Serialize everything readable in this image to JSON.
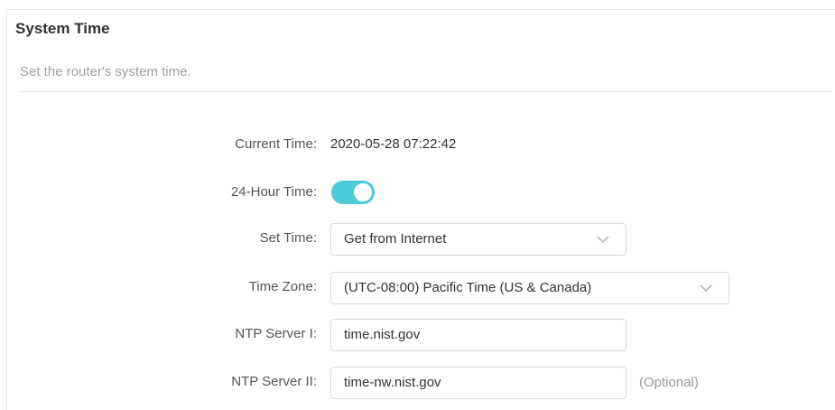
{
  "section": {
    "title": "System Time",
    "subtitle": "Set the router's system time."
  },
  "fields": {
    "current_time": {
      "label": "Current Time:",
      "value": "2020-05-28 07:22:42"
    },
    "hour24": {
      "label": "24-Hour Time:",
      "enabled": true
    },
    "set_time": {
      "label": "Set Time:",
      "value": "Get from Internet"
    },
    "time_zone": {
      "label": "Time Zone:",
      "value": "(UTC-08:00) Pacific Time (US & Canada)"
    },
    "ntp1": {
      "label": "NTP Server I:",
      "value": "time.nist.gov"
    },
    "ntp2": {
      "label": "NTP Server II:",
      "value": "time-nw.nist.gov",
      "hint": "(Optional)"
    }
  },
  "icons": {
    "dropdown": "chevron-down-icon"
  },
  "colors": {
    "toggle_on": "#4acbd6"
  }
}
